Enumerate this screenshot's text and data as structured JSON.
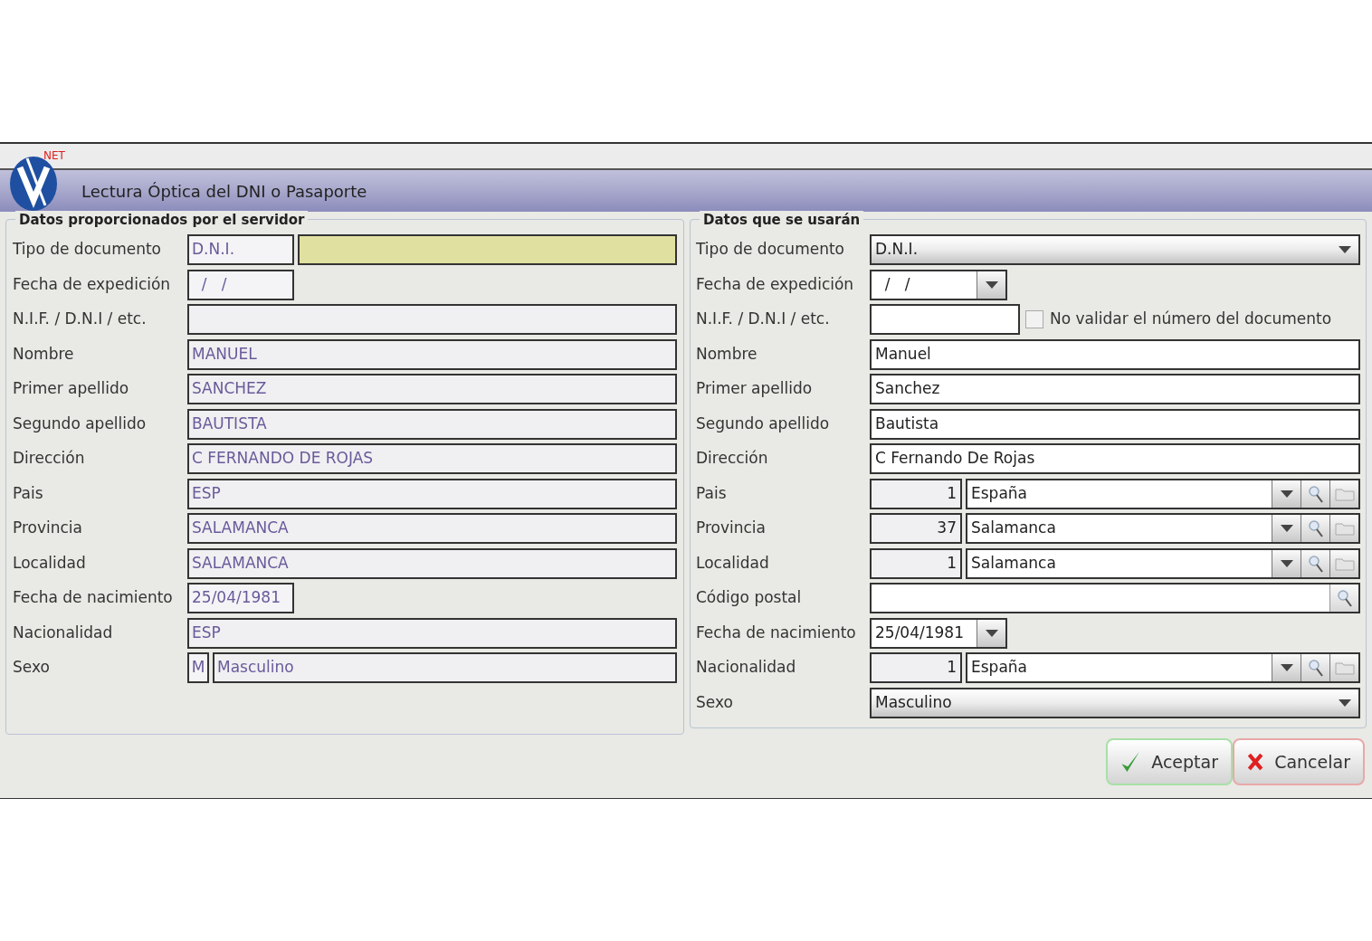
{
  "window": {
    "title": "Lectura Óptica del DNI o Pasaporte",
    "logo_text": "NET"
  },
  "server_panel": {
    "title": "Datos proporcionados por el servidor",
    "rows": [
      {
        "label": "Tipo de documento",
        "fields": [
          {
            "kind": "short",
            "value": "D.N.I."
          },
          {
            "kind": "highlight"
          }
        ]
      },
      {
        "label": "Fecha de expedición",
        "fields": [
          {
            "kind": "short",
            "value": "  /   /"
          }
        ]
      },
      {
        "label": "N.I.F. / D.N.I / etc.",
        "fields": [
          {
            "kind": "wide"
          }
        ]
      },
      {
        "label": "Nombre",
        "fields": [
          {
            "kind": "wide",
            "value": "MANUEL"
          }
        ]
      },
      {
        "label": "Primer apellido",
        "fields": [
          {
            "kind": "wide",
            "value": "SANCHEZ"
          }
        ]
      },
      {
        "label": "Segundo apellido",
        "fields": [
          {
            "kind": "wide",
            "value": "BAUTISTA"
          }
        ]
      },
      {
        "label": "Dirección",
        "fields": [
          {
            "kind": "wide",
            "value": "C FERNANDO DE ROJAS"
          }
        ]
      },
      {
        "label": "Pais",
        "fields": [
          {
            "kind": "wide",
            "value": "ESP"
          }
        ]
      },
      {
        "label": "Provincia",
        "fields": [
          {
            "kind": "wide",
            "value": "SALAMANCA"
          }
        ]
      },
      {
        "label": "Localidad",
        "fields": [
          {
            "kind": "wide",
            "value": "SALAMANCA"
          }
        ]
      },
      {
        "label": "Fecha de nacimiento",
        "fields": [
          {
            "kind": "short",
            "value": "25/04/1981"
          }
        ]
      },
      {
        "label": "Nacionalidad",
        "fields": [
          {
            "kind": "wide",
            "value": "ESP"
          }
        ]
      },
      {
        "label": "Sexo",
        "fields": [
          {
            "kind": "code",
            "value": "M"
          },
          {
            "kind": "wide",
            "value": "Masculino"
          }
        ]
      }
    ]
  },
  "used_panel": {
    "title": "Datos que se usarán",
    "rows": [
      {
        "label": "Tipo de documento",
        "kind": "combo",
        "value": "D.N.I."
      },
      {
        "label": "Fecha de expedición",
        "kind": "date",
        "value": "  /   /"
      },
      {
        "label": "N.I.F. / D.N.I / etc.",
        "kind": "check",
        "checkbox_label": "No validar el número del documento",
        "checked": false
      },
      {
        "label": "Nombre",
        "kind": "text",
        "value": "Manuel"
      },
      {
        "label": "Primer apellido",
        "kind": "text",
        "value": "Sanchez"
      },
      {
        "label": "Segundo apellido",
        "kind": "text",
        "value": "Bautista"
      },
      {
        "label": "Dirección",
        "kind": "text",
        "value": "C Fernando De Rojas"
      },
      {
        "label": "Pais",
        "kind": "lookup",
        "code": "1",
        "value": "España"
      },
      {
        "label": "Provincia",
        "kind": "lookup",
        "code": "37",
        "value": "Salamanca"
      },
      {
        "label": "Localidad",
        "kind": "lookup",
        "code": "1",
        "value": "Salamanca"
      },
      {
        "label": "Código postal",
        "kind": "search"
      },
      {
        "label": "Fecha de nacimiento",
        "kind": "date",
        "value": "25/04/1981"
      },
      {
        "label": "Nacionalidad",
        "kind": "lookup",
        "code": "1",
        "value": "España"
      },
      {
        "label": "Sexo",
        "kind": "combo",
        "value": "Masculino"
      }
    ]
  },
  "buttons": [
    {
      "kind": "accept",
      "label": "Aceptar"
    },
    {
      "kind": "cancel",
      "label": "Cancelar"
    }
  ]
}
